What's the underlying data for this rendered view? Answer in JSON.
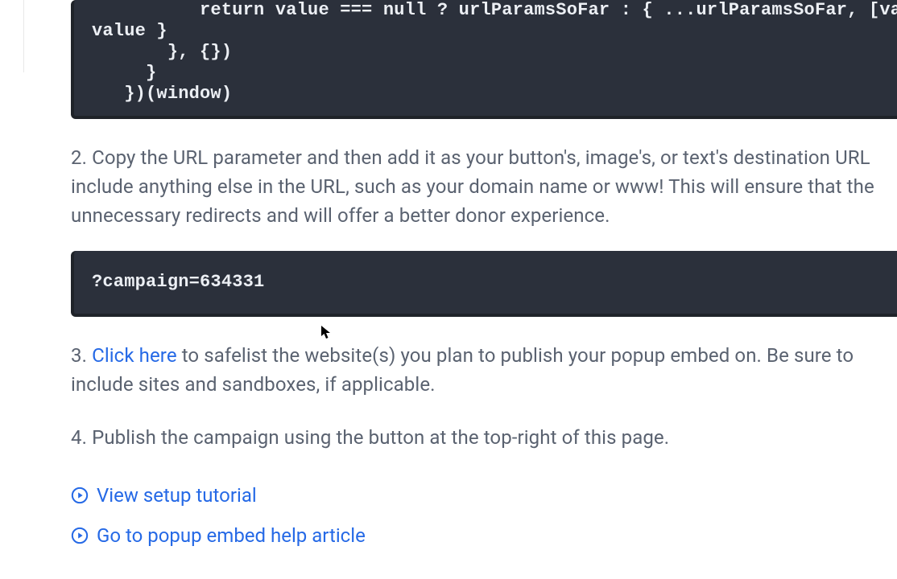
{
  "code_block_1": "          return value === null ? urlParamsSoFar : { ...urlParamsSoFar, [val\nvalue }\n       }, {})\n     }\n   })(window)",
  "code_block_2": "?campaign=634331",
  "step2": {
    "num": "2.",
    "text": "Copy the URL parameter and then add it as your button's, image's, or text's destination URL include anything else in the URL, such as your domain name or www! This will ensure that the unnecessary redirects and will offer a better donor experience."
  },
  "step3": {
    "num": "3.",
    "link_text": "Click here",
    "text_after": " to safelist the website(s) you plan to publish your popup embed on. Be sure to include sites and sandboxes, if applicable."
  },
  "step4": {
    "num": "4.",
    "text": "Publish the campaign using the button at the top-right of this page."
  },
  "links": {
    "tutorial": "View setup tutorial",
    "help_article": "Go to popup embed help article"
  }
}
